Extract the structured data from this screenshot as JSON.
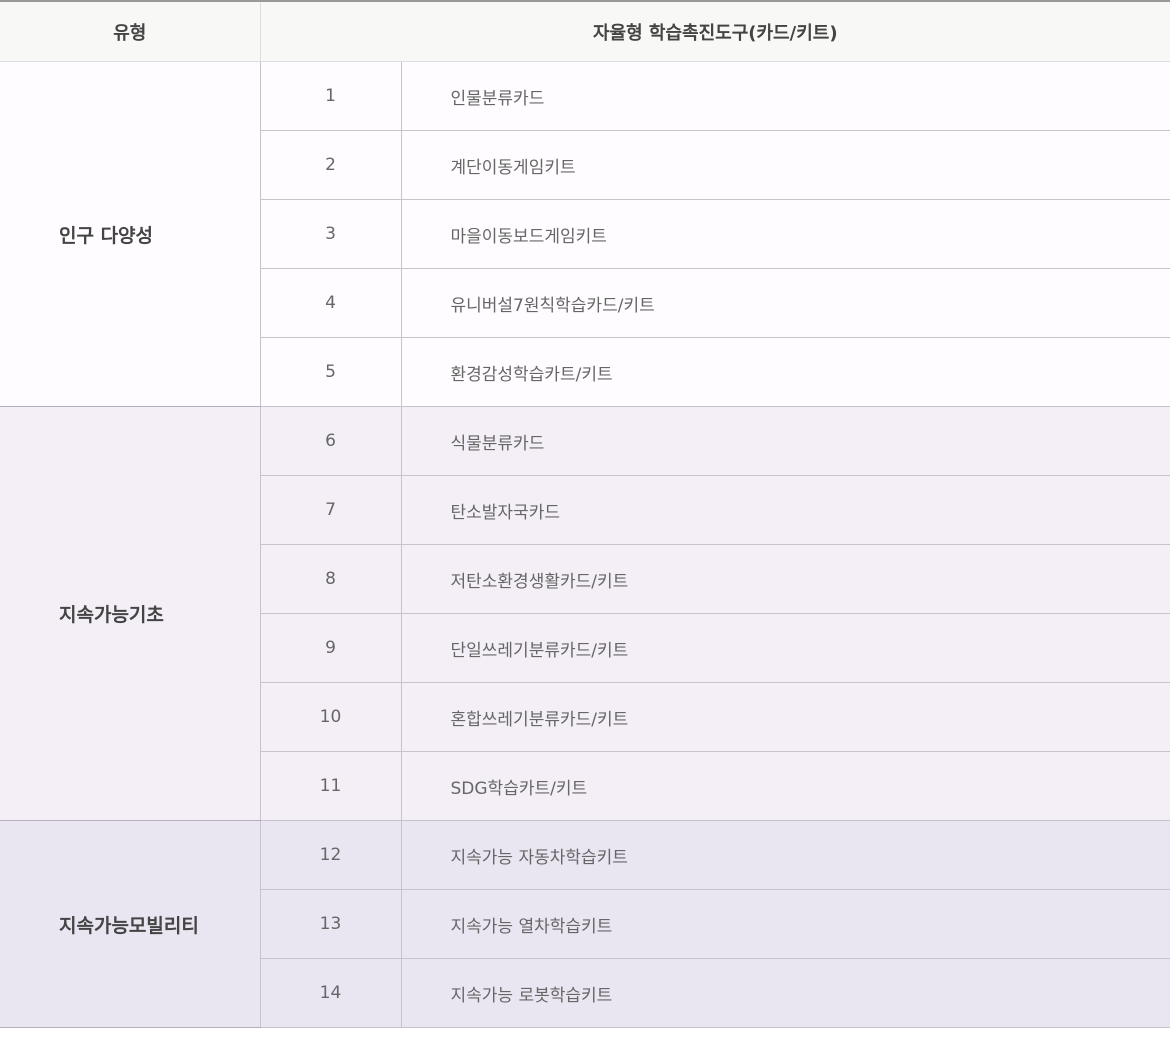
{
  "header": {
    "type_label": "유형",
    "tool_label": "자율형 학습촉진도구(카드/키트)"
  },
  "groups": [
    {
      "type": "인구 다양성",
      "color": "#fefcfe",
      "rows": [
        {
          "num": "1",
          "name": "인물분류카드"
        },
        {
          "num": "2",
          "name": "계단이동게임키트"
        },
        {
          "num": "3",
          "name": "마을이동보드게임키트"
        },
        {
          "num": "4",
          "name": "유니버설7원칙학습카드/키트"
        },
        {
          "num": "5",
          "name": "환경감성학습카트/키트"
        }
      ]
    },
    {
      "type": "지속가능기초",
      "color": "#f4eff7",
      "rows": [
        {
          "num": "6",
          "name": "식물분류카드"
        },
        {
          "num": "7",
          "name": "탄소발자국카드"
        },
        {
          "num": "8",
          "name": "저탄소환경생활카드/키트"
        },
        {
          "num": "9",
          "name": "단일쓰레기분류카드/키트"
        },
        {
          "num": "10",
          "name": "혼합쓰레기분류카드/키트"
        },
        {
          "num": "11",
          "name": "SDG학습카트/키트"
        }
      ]
    },
    {
      "type": "지속가능모빌리티",
      "color": "#e9e6f2",
      "rows": [
        {
          "num": "12",
          "name": "지속가능 자동차학습키트"
        },
        {
          "num": "13",
          "name": "지속가능 열차학습키트"
        },
        {
          "num": "14",
          "name": "지속가능 로봇학습키트"
        }
      ]
    }
  ]
}
